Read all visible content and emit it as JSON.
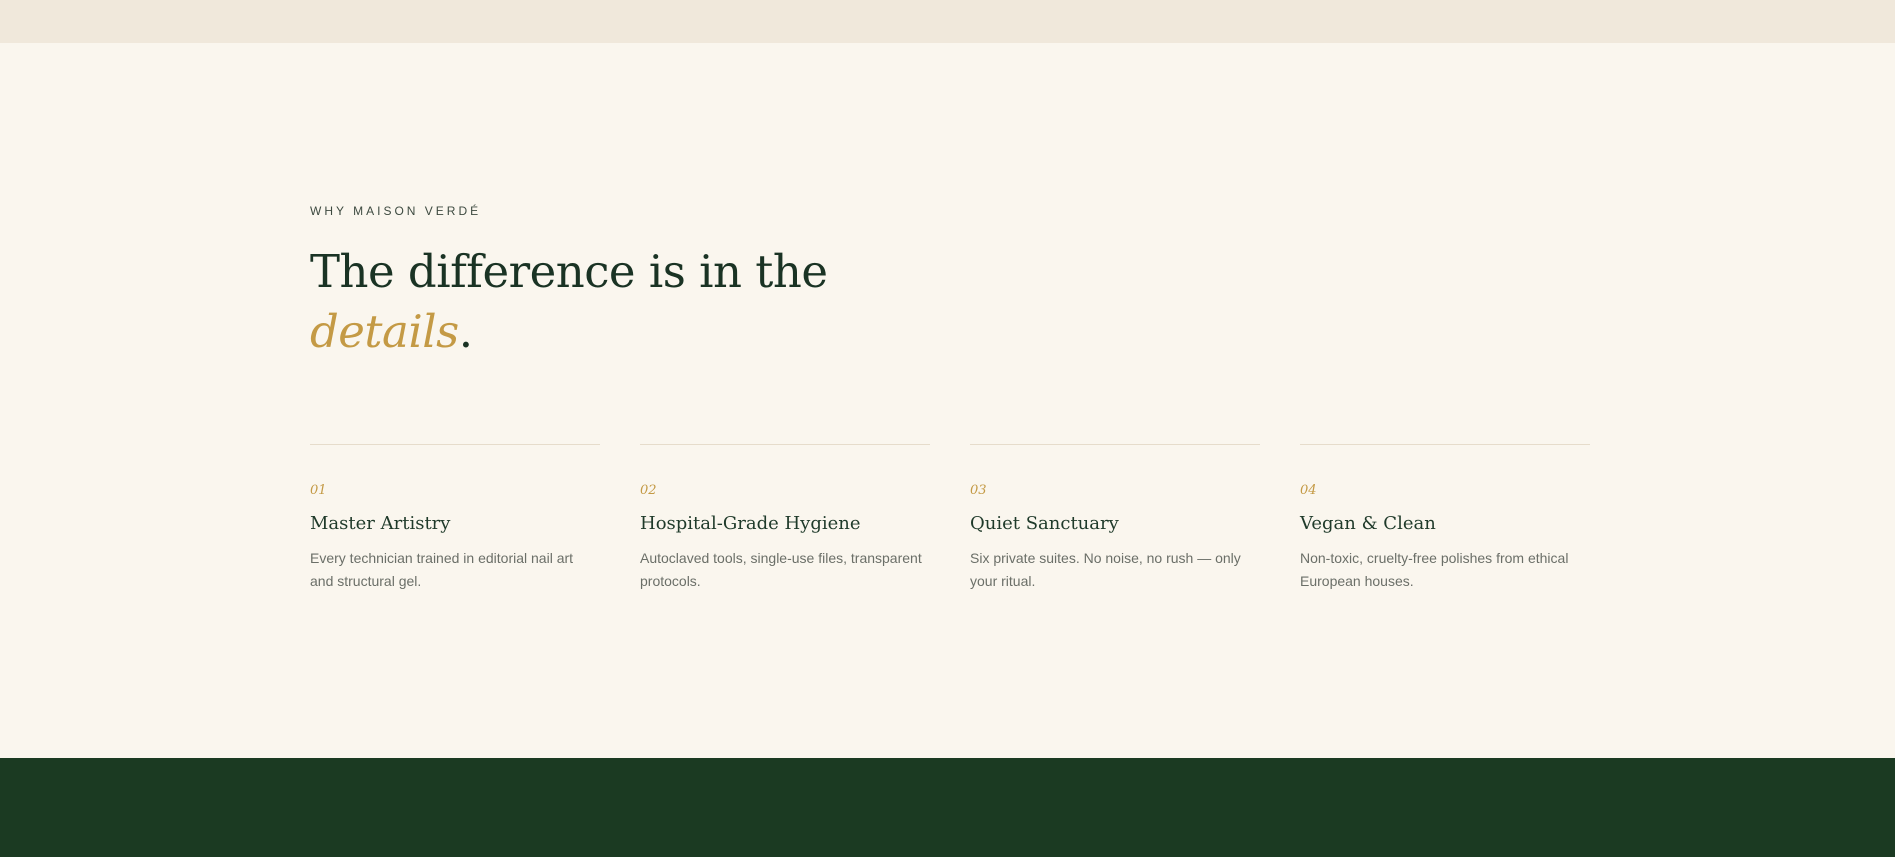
{
  "section": {
    "eyebrow": "WHY MAISON VERDÉ",
    "headline": {
      "line1": "The difference is in the",
      "accent": "details",
      "period": "."
    }
  },
  "features": [
    {
      "number": "01",
      "title": "Master Artistry",
      "description": "Every technician trained in editorial nail art and structural gel."
    },
    {
      "number": "02",
      "title": "Hospital-Grade Hygiene",
      "description": "Autoclaved tools, single-use files, transparent protocols."
    },
    {
      "number": "03",
      "title": "Quiet Sanctuary",
      "description": "Six private suites. No noise, no rush — only your ritual."
    },
    {
      "number": "04",
      "title": "Vegan & Clean",
      "description": "Non-toxic, cruelty-free polishes from ethical European houses."
    }
  ],
  "colors": {
    "background": "#faf6ee",
    "top_band": "#f0e8db",
    "footer_band": "#1b3a22",
    "accent_gold": "#c49a45",
    "heading_green": "#1a3324"
  }
}
